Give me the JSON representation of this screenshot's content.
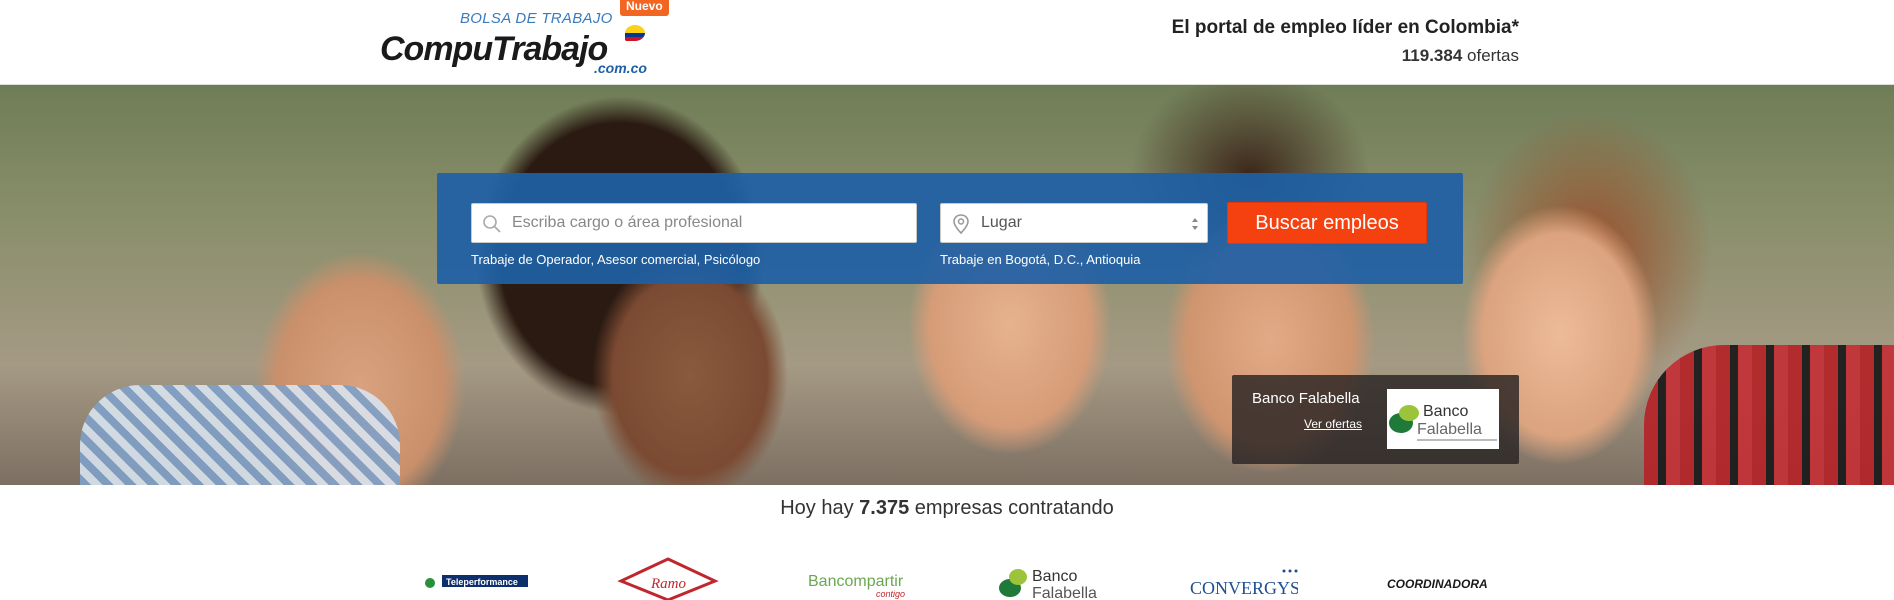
{
  "header": {
    "logo_tag": "BOLSA DE TRABAJO",
    "logo_new": "Nuevo",
    "logo_name": "CompuTrabajo",
    "logo_domain": ".com.co",
    "tagline": "El portal de empleo líder en Colombia*",
    "offers_count": "119.384",
    "offers_label": "ofertas"
  },
  "search": {
    "keyword_placeholder": "Escriba cargo o área profesional",
    "location_value": "Lugar",
    "button_label": "Buscar empleos",
    "keyword_hint": "Trabaje de Operador, Asesor comercial, Psicólogo",
    "location_hint": "Trabaje en Bogotá, D.C., Antioquia"
  },
  "sponsor": {
    "name": "Banco Falabella",
    "link": "Ver ofertas"
  },
  "companies": {
    "prefix": "Hoy hay",
    "count": "7.375",
    "suffix": "empresas contratando",
    "logos": [
      "Teleperformance",
      "Ramo",
      "Bancompartir",
      "Banco Falabella",
      "CONVERGYS",
      "COORDINADORA"
    ]
  },
  "colors": {
    "brand_blue": "#1e5fa5",
    "button_orange": "#f5410f",
    "new_badge": "#f26522"
  },
  "icons": [
    "search-icon",
    "location-pin-icon",
    "select-arrows-icon",
    "colombia-flag-icon"
  ]
}
